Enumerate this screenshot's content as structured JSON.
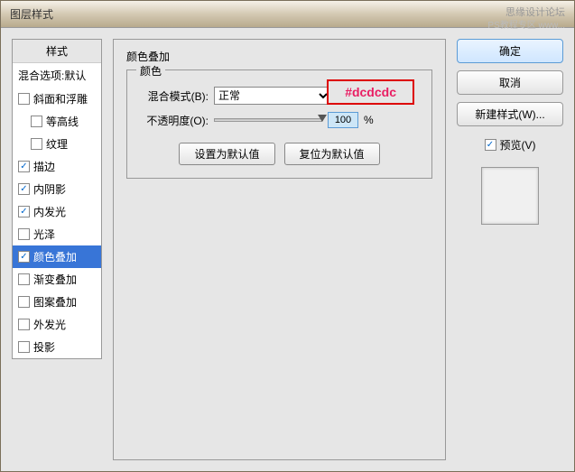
{
  "watermark": {
    "main": "思缘设计论坛",
    "sub": "PS教程专区 www..."
  },
  "titlebar": "图层样式",
  "sidebar": {
    "header": "样式",
    "default_label": "混合选项:默认",
    "items": [
      {
        "label": "斜面和浮雕",
        "checked": false,
        "indent": false
      },
      {
        "label": "等高线",
        "checked": false,
        "indent": true
      },
      {
        "label": "纹理",
        "checked": false,
        "indent": true
      },
      {
        "label": "描边",
        "checked": true,
        "indent": false
      },
      {
        "label": "内阴影",
        "checked": true,
        "indent": false
      },
      {
        "label": "内发光",
        "checked": true,
        "indent": false
      },
      {
        "label": "光泽",
        "checked": false,
        "indent": false
      },
      {
        "label": "颜色叠加",
        "checked": true,
        "indent": false,
        "selected": true
      },
      {
        "label": "渐变叠加",
        "checked": false,
        "indent": false
      },
      {
        "label": "图案叠加",
        "checked": false,
        "indent": false
      },
      {
        "label": "外发光",
        "checked": false,
        "indent": false
      },
      {
        "label": "投影",
        "checked": false,
        "indent": false
      }
    ]
  },
  "main": {
    "section_title": "颜色叠加",
    "group_label": "颜色",
    "annotation": "#dcdcdc",
    "blend_mode_label": "混合模式(B):",
    "blend_mode_value": "正常",
    "opacity_label": "不透明度(O):",
    "opacity_value": "100",
    "opacity_unit": "%",
    "reset_default": "设置为默认值",
    "revert_default": "复位为默认值"
  },
  "right": {
    "ok": "确定",
    "cancel": "取消",
    "new_style": "新建样式(W)...",
    "preview_label": "预览(V)"
  }
}
